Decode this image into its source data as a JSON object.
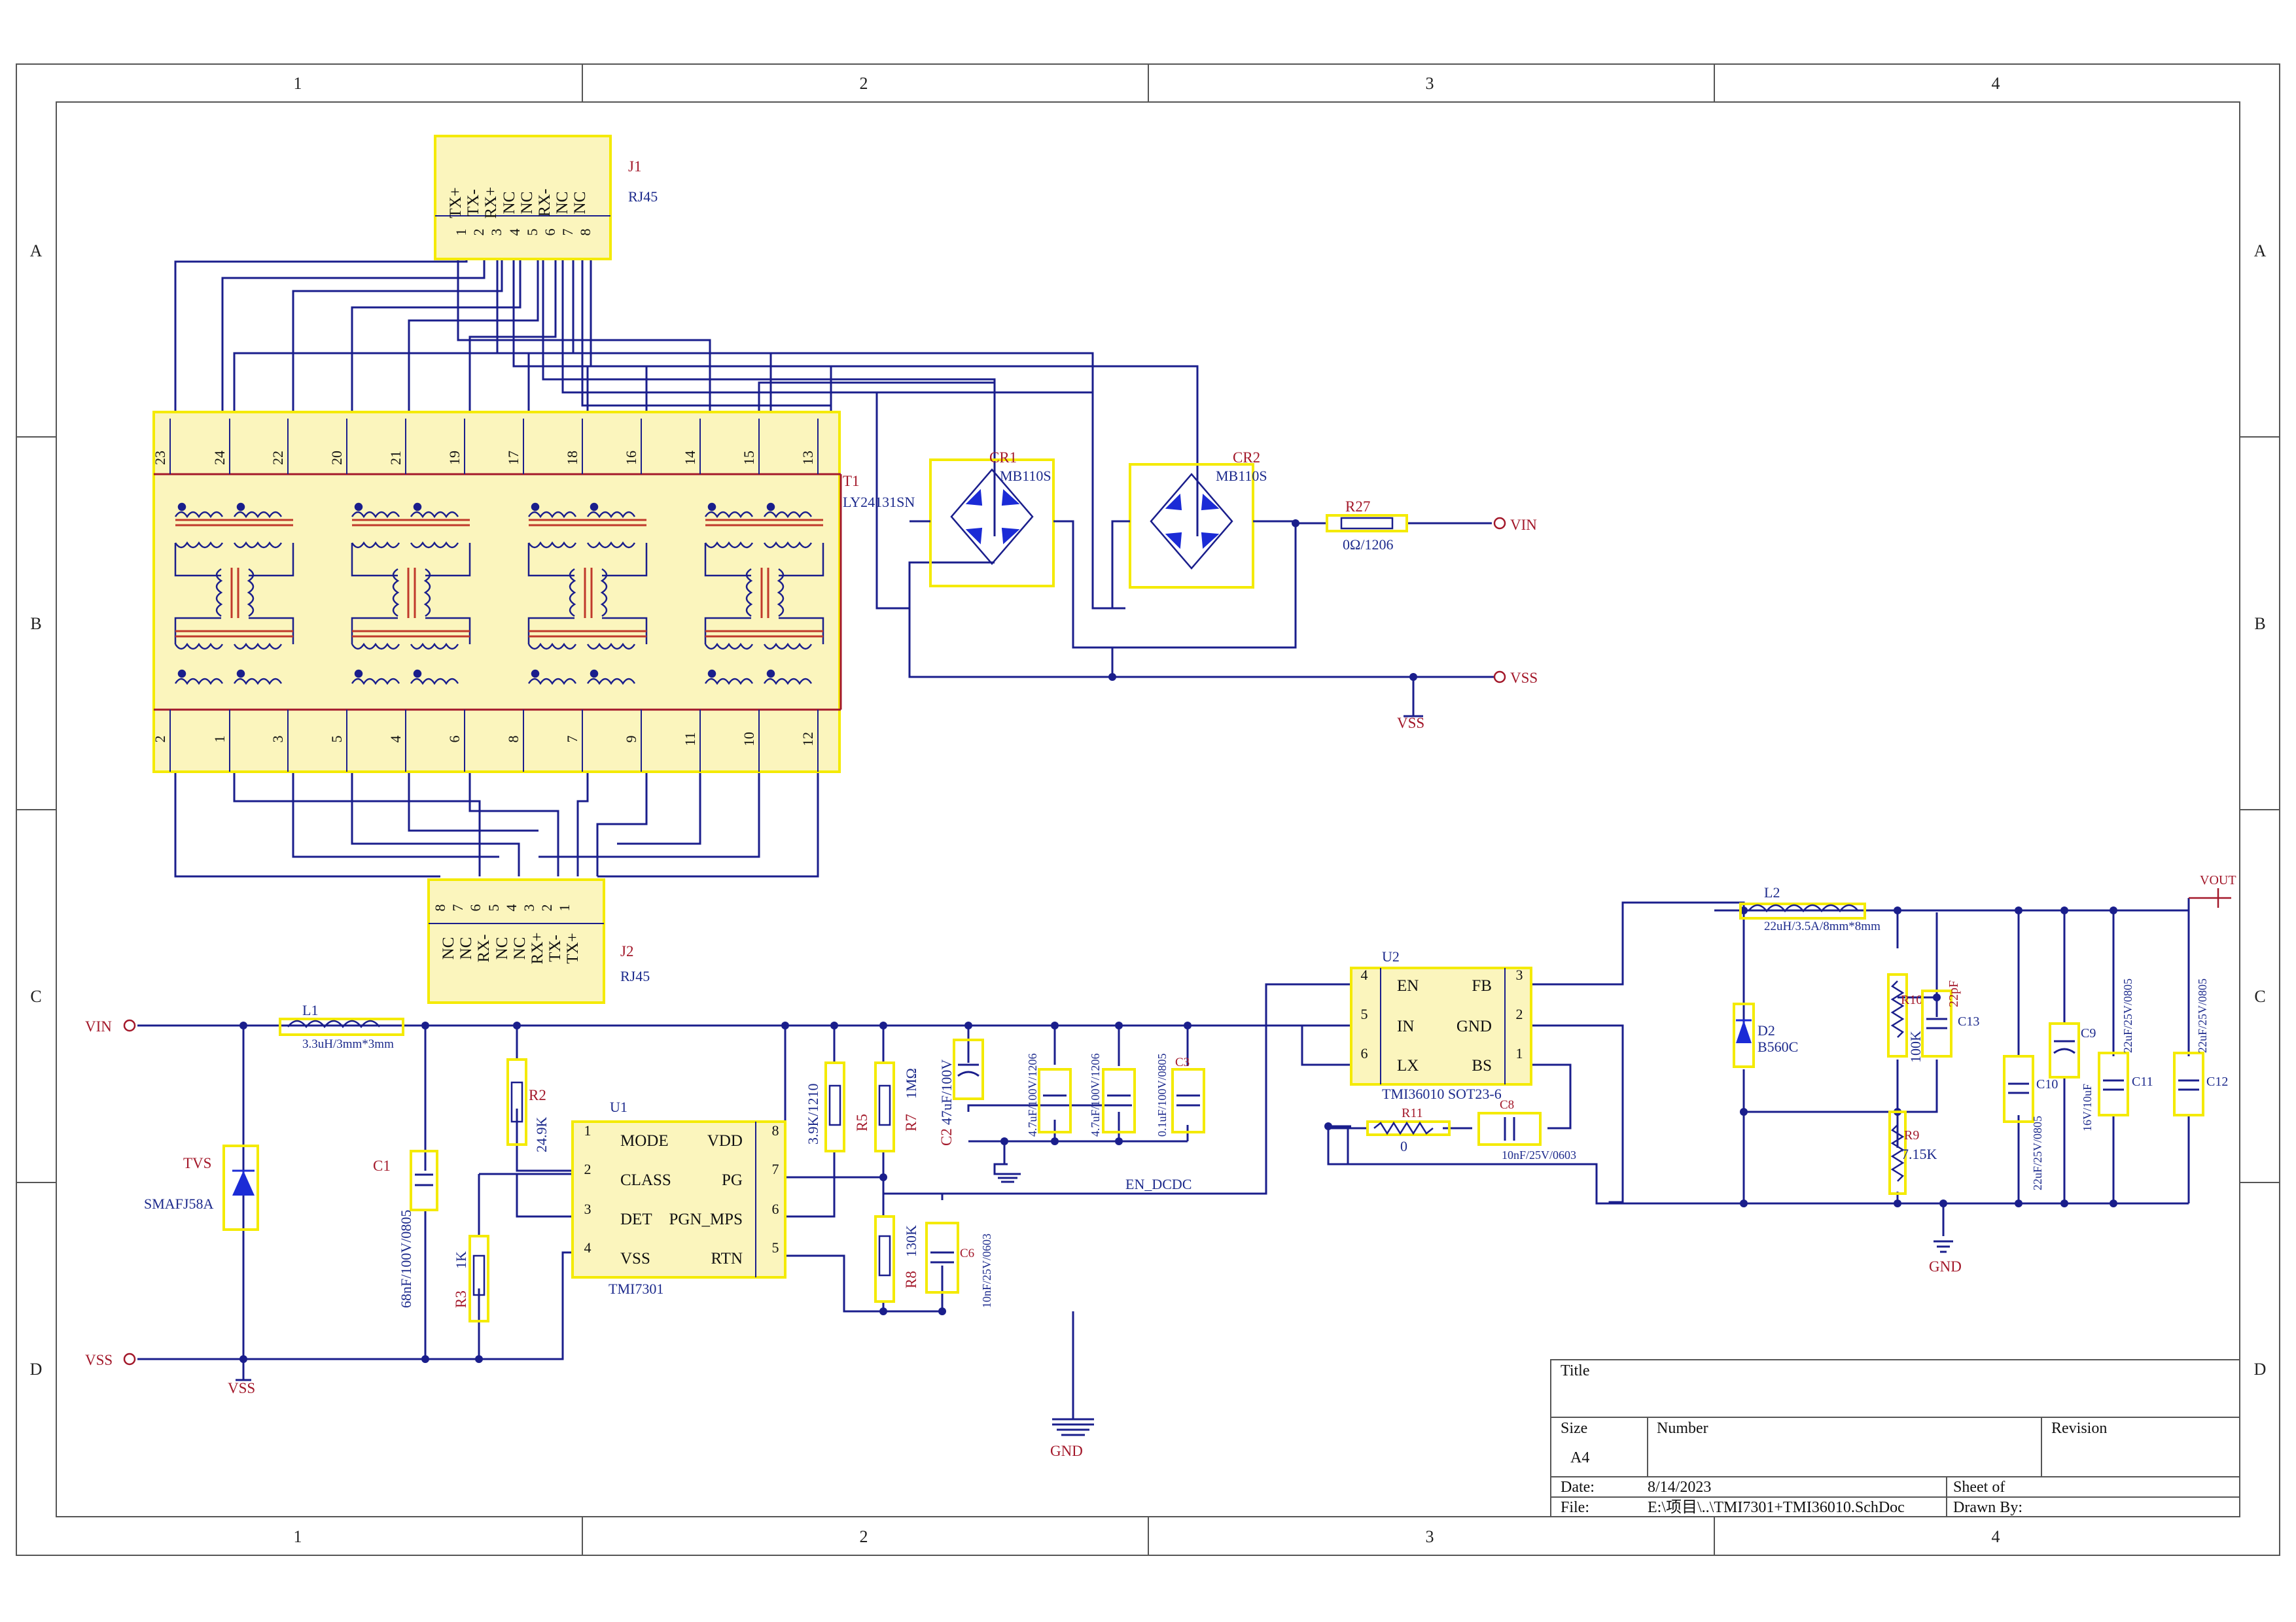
{
  "frame": {
    "cols": [
      "1",
      "2",
      "3",
      "4"
    ],
    "rows": [
      "A",
      "B",
      "C",
      "D"
    ]
  },
  "connectors": {
    "j1": {
      "ref": "J1",
      "type": "RJ45",
      "pin_names": [
        "TX+",
        "TX-",
        "RX+",
        "NC",
        "NC",
        "RX-",
        "NC",
        "NC"
      ],
      "pin_numbers": [
        "1",
        "2",
        "3",
        "4",
        "5",
        "6",
        "7",
        "8"
      ]
    },
    "j2": {
      "ref": "J2",
      "type": "RJ45",
      "pin_names": [
        "NC",
        "NC",
        "RX-",
        "NC",
        "NC",
        "RX+",
        "TX-",
        "TX+"
      ],
      "pin_numbers": [
        "8",
        "7",
        "6",
        "5",
        "4",
        "3",
        "2",
        "1"
      ]
    }
  },
  "transformer": {
    "ref": "T1",
    "value": "LY24131SN",
    "top_pins": [
      "23",
      "24",
      "22",
      "20",
      "21",
      "19",
      "17",
      "18",
      "16",
      "14",
      "15",
      "13"
    ],
    "bottom_pins": [
      "2",
      "1",
      "3",
      "5",
      "4",
      "6",
      "8",
      "7",
      "9",
      "11",
      "10",
      "12"
    ]
  },
  "bridges": [
    {
      "ref": "CR1",
      "value": "MB110S"
    },
    {
      "ref": "CR2",
      "value": "MB110S"
    }
  ],
  "components": {
    "r27": {
      "ref": "R27",
      "value": "0Ω/1206"
    },
    "l1": {
      "ref": "L1",
      "value": "3.3uH/3mm*3mm"
    },
    "l2": {
      "ref": "L2",
      "value": "22uH/3.5A/8mm*8mm"
    },
    "tvs": {
      "ref": "TVS",
      "value": "SMAFJ58A"
    },
    "c1": {
      "ref": "C1",
      "value": "68nF/100V/0805"
    },
    "r2": {
      "ref": "R2",
      "value": "24.9K"
    },
    "r3": {
      "ref": "R3",
      "value": "1K"
    },
    "r4": {
      "value": "3.9K/1210"
    },
    "r5": {
      "ref": "R5"
    },
    "r7": {
      "ref": "R7",
      "value": "1MΩ"
    },
    "r8": {
      "ref": "R8",
      "value": "130K"
    },
    "c6": {
      "ref": "C6",
      "value": "10nF/25V/0603"
    },
    "c2": {
      "ref": "C2",
      "value": "47uF/100V"
    },
    "c4": {
      "value": "4.7uF/100V/1206"
    },
    "c5": {
      "value": "4.7uF/100V/1206"
    },
    "c3": {
      "ref": "C3",
      "value": "0.1uF/100V/0805"
    },
    "r11": {
      "ref": "R11",
      "value": "0"
    },
    "c8": {
      "ref": "C8",
      "value": "10nF/25V/0603"
    },
    "d2": {
      "ref": "D2",
      "value": "B560C"
    },
    "r10": {
      "ref": "R10",
      "value": "100K"
    },
    "c13": {
      "ref": "C13",
      "value": "22pF"
    },
    "r9": {
      "ref": "R9",
      "value": "7.15K"
    },
    "c10": {
      "ref": "C10",
      "value": "22uF/25V/0805"
    },
    "c9": {
      "ref": "C9",
      "value": "16V/10uF"
    },
    "c11": {
      "ref": "C11",
      "value": "22uF/25V/0805"
    },
    "c12": {
      "ref": "C12",
      "value": "22uF/25V/0805"
    }
  },
  "ics": {
    "u1": {
      "ref": "U1",
      "value": "TMI7301",
      "left_pins": [
        {
          "num": "1",
          "name": "MODE"
        },
        {
          "num": "2",
          "name": "CLASS"
        },
        {
          "num": "3",
          "name": "DET"
        },
        {
          "num": "4",
          "name": "VSS"
        }
      ],
      "right_pins": [
        {
          "num": "8",
          "name": "VDD"
        },
        {
          "num": "7",
          "name": "PG"
        },
        {
          "num": "6",
          "name": "PGN_MPS"
        },
        {
          "num": "5",
          "name": "RTN"
        }
      ]
    },
    "u2": {
      "ref": "U2",
      "value": "TMI36010 SOT23-6",
      "left_pins": [
        {
          "num": "4",
          "name": "EN"
        },
        {
          "num": "5",
          "name": "IN"
        },
        {
          "num": "6",
          "name": "LX"
        }
      ],
      "right_pins": [
        {
          "num": "3",
          "name": "FB"
        },
        {
          "num": "2",
          "name": "GND"
        },
        {
          "num": "1",
          "name": "BS"
        }
      ]
    }
  },
  "nets": {
    "vin": "VIN",
    "vss": "VSS",
    "gnd": "GND",
    "vout": "VOUT",
    "en": "EN_DCDC"
  },
  "title_block": {
    "title_label": "Title",
    "size_label": "Size",
    "size_value": "A4",
    "number_label": "Number",
    "revision_label": "Revision",
    "date_label": "Date:",
    "date_value": "8/14/2023",
    "file_label": "File:",
    "file_value": "E:\\项目\\..\\TMI7301+TMI36010.SchDoc",
    "sheet_label": "Sheet   of",
    "drawn_label": "Drawn By:"
  },
  "colors": {
    "wire": "#1a1e8c",
    "ref_text": "#a3182a",
    "value_text": "#1c2a8c",
    "highlight": "#f4ea00",
    "body_fill": "#fbf5bd"
  }
}
